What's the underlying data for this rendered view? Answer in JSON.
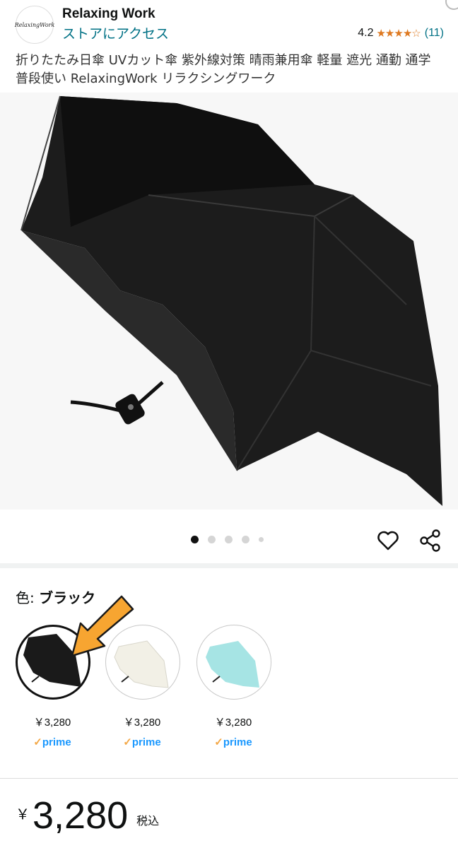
{
  "store": {
    "logo_text": "RelaxingWork",
    "name": "Relaxing Work",
    "link": "ストアにアクセス",
    "rating_value": "4.2",
    "stars": "★★★★☆",
    "rating_count": "(11)"
  },
  "product": {
    "title": "折りたたみ日傘 UVカット傘 紫外線対策 晴雨兼用傘 軽量 遮光 通勤 通学 普段使い RelaxingWork リラクシングワーク"
  },
  "carousel": {
    "total": 5,
    "active_index": 0
  },
  "icons": {
    "favorite": "heart-icon",
    "share": "share-icon"
  },
  "variation": {
    "label": "色: ",
    "selected": "ブラック",
    "options": [
      {
        "color": "#1a1a1a",
        "price": "￥3,280",
        "prime": "prime"
      },
      {
        "color": "#f2f0e6",
        "price": "￥3,280",
        "prime": "prime"
      },
      {
        "color": "#a6e4e4",
        "price": "￥3,280",
        "prime": "prime"
      }
    ]
  },
  "price": {
    "currency": "￥",
    "amount": "3,280",
    "tax_note": "税込"
  },
  "colors": {
    "link": "#007185",
    "star": "#de7921",
    "prime_blue": "#1a98ff",
    "arrow": "#f7a531"
  }
}
